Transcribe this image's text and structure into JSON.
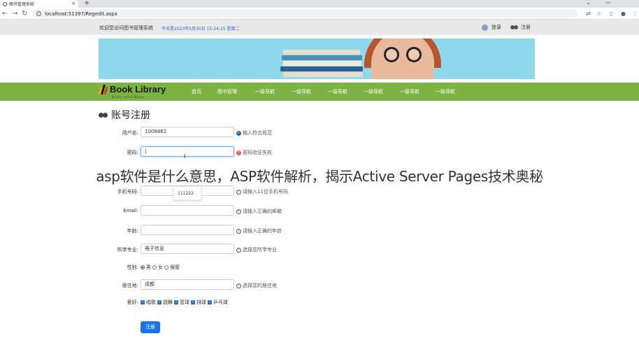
{
  "browser": {
    "tab_title": "图书管理系统",
    "tab_close": "×",
    "new_tab": "+",
    "url": "localhost:51397/Regedit.aspx",
    "window_controls": [
      "⌄",
      "—"
    ]
  },
  "topbar": {
    "welcome": "欢迎您访问图书管理系统",
    "date": "今天是2023年5月30日 15:24:25 星期二",
    "login": "登录",
    "register": "注册"
  },
  "nav": {
    "logo_title": "Book Library",
    "logo_sub": "Books and E-Books",
    "items": [
      "首页",
      "图书管理",
      "一级导航",
      "一级导航",
      "一级导航",
      "一级导航",
      "一级导航",
      "一级导航"
    ]
  },
  "form": {
    "title": "账号注册",
    "username_label": "用户名:",
    "username_value": "1008862",
    "username_hint": "输入符合规范",
    "password_label": "密码:",
    "password_value": "|",
    "password_hint": "密码验证失败",
    "phone_label": "手机号码:",
    "phone_hint": "请输入11位手机号码",
    "phone_suggestion": "111222",
    "email_label": "Email:",
    "email_hint": "请输入正确的邮箱",
    "age_label": "年龄:",
    "age_hint": "请输入正确的年龄",
    "major_label": "所学专业:",
    "major_value": "电子信息",
    "major_hint": "选择您所学专业",
    "gender_label": "性别:",
    "gender_options": [
      "男",
      "女",
      "保密"
    ],
    "gender_selected": "男",
    "address_label": "居住地:",
    "address_value": "成都",
    "address_hint": "选择您的居住地",
    "hobby_label": "爱好:",
    "hobbies": [
      "唱歌",
      "跳舞",
      "篮球",
      "排球",
      "乒乓球"
    ],
    "submit": "注册"
  },
  "overlay_text": "asp软件是什么意思，ASP软件解析，揭示Active Server Pages技术奥秘",
  "colors": {
    "nav_green": "#7cb342",
    "banner_blue": "#8fd9ef",
    "link_blue": "#2a6cb0",
    "button_blue": "#1a73e8"
  }
}
